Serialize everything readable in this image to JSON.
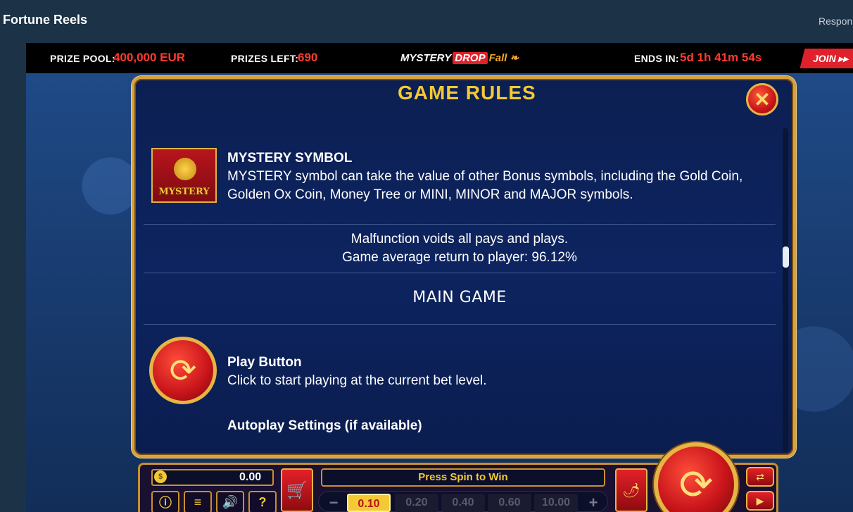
{
  "app": {
    "title": "Fortune Reels",
    "respon": "Respon"
  },
  "promo": {
    "prize_pool_label": "PRIZE POOL:",
    "prize_pool_value": "400,000 EUR",
    "prizes_left_label": "PRIZES LEFT:",
    "prizes_left_value": "690",
    "logo_mystery": "MYSTERY",
    "logo_drop": "DROP",
    "logo_fall": "Fall",
    "ends_label": "ENDS IN:",
    "ends_value": "5d 1h 41m 54s",
    "join_label": "JOIN"
  },
  "rules": {
    "title": "GAME RULES",
    "mystery_icon_text": "MYSTERY",
    "mystery_heading": "MYSTERY SYMBOL",
    "mystery_line1": "MYSTERY symbol can take the value of other Bonus symbols, including the Gold Coin,",
    "mystery_line2": "Golden Ox Coin, Money Tree or MINI, MINOR and MAJOR symbols.",
    "malfunction": "Malfunction voids all pays and plays.",
    "rtp": "Game average return to player: 96.12%",
    "main_game": "MAIN GAME",
    "play_heading": "Play Button",
    "play_desc": "Click to start playing at the current bet level.",
    "autoplay_heading": "Autoplay Settings (if available)"
  },
  "controls": {
    "balance": "0.00",
    "message": "Press Spin to Win",
    "bets": [
      "0.10",
      "0.20",
      "0.40",
      "0.60",
      "10.00"
    ],
    "selected_bet": "0.10",
    "minus": "−",
    "plus": "+"
  },
  "colors": {
    "accent_gold": "#f3c935",
    "accent_red": "#e0202b",
    "panel_bg": "#0c1f52"
  }
}
